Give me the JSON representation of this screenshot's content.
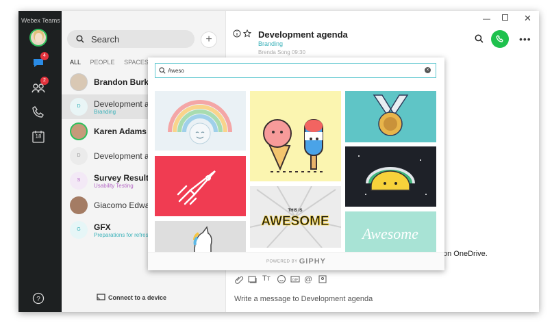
{
  "app": {
    "title": "Webex Teams"
  },
  "rail": {
    "messages_badge": "4",
    "teams_badge": "2",
    "calendar_day": "18"
  },
  "list": {
    "search_placeholder": "Search",
    "filters": [
      "ALL",
      "PEOPLE",
      "SPACES"
    ],
    "rows": [
      {
        "name": "Brandon Burke",
        "initial": "",
        "sub": ""
      },
      {
        "name": "Development agenda",
        "initial": "D",
        "sub": "Branding"
      },
      {
        "name": "Karen Adams",
        "initial": "",
        "sub": ""
      },
      {
        "name": "Development agenda",
        "initial": "D",
        "sub": ""
      },
      {
        "name": "Survey Results",
        "initial": "S",
        "sub": "Usability Testing"
      },
      {
        "name": "Giacomo Edwards",
        "initial": "",
        "sub": ""
      },
      {
        "name": "GFX",
        "initial": "G",
        "sub": "Preparations for refresh"
      }
    ],
    "connect_label": "Connect to a device"
  },
  "chat": {
    "title": "Development agenda",
    "subtitle": "Branding",
    "faded_message": "Brenda Song 09:30",
    "message_tail": "on OneDrive.",
    "composer_placeholder": "Write a message to Development agenda"
  },
  "giphy": {
    "search_value": "Aweso",
    "powered_prefix": "POWERED BY",
    "powered_brand": "GIPHY",
    "gif_texts": {
      "awesome_banner": "AWESOME",
      "awesome_small": "THIS IS",
      "awesome_script": "Awesome"
    }
  },
  "colors": {
    "rail": "#1d2021",
    "accent": "#39b1b9",
    "call": "#1ec14d",
    "badge": "#e3333d"
  }
}
